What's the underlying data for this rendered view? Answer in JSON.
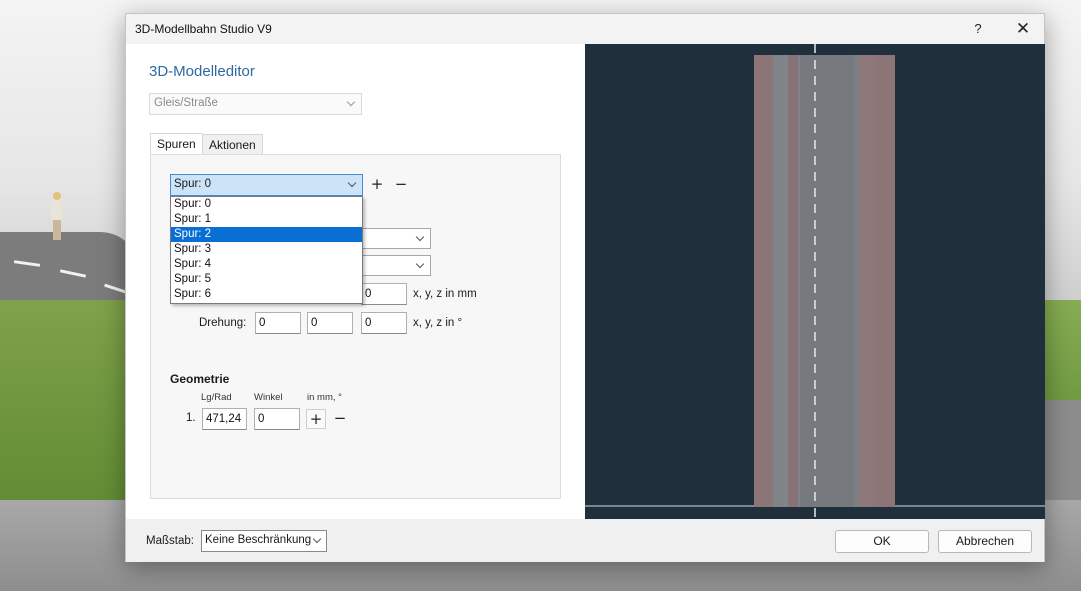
{
  "window": {
    "title": "3D-Modellbahn Studio V9",
    "help_label": "?",
    "close_label": "✕"
  },
  "editor": {
    "heading": "3D-Modelleditor",
    "type_select": {
      "value": "Gleis/Straße"
    },
    "tabs": [
      {
        "label": "Spuren",
        "active": true
      },
      {
        "label": "Aktionen",
        "active": false
      }
    ],
    "spur_select": {
      "value": "Spur: 0"
    },
    "add_label": "+",
    "remove_label": "−",
    "spur_options": [
      "Spur: 0",
      "Spur: 1",
      "Spur: 2",
      "Spur: 3",
      "Spur: 4",
      "Spur: 5",
      "Spur: 6"
    ],
    "highlighted_option": "Spur: 2",
    "position": {
      "z_value": "0",
      "unit_label": "x, y, z in mm"
    },
    "rotation": {
      "label": "Drehung:",
      "x": "0",
      "y": "0",
      "z": "0",
      "unit_label": "x, y, z in °"
    },
    "geometry": {
      "heading": "Geometrie",
      "col_length": "Lg/Rad",
      "col_angle": "Winkel",
      "col_unit": "in mm, °",
      "rows": [
        {
          "index": "1.",
          "length": "471,24",
          "angle": "0"
        }
      ],
      "add_label": "+",
      "remove_label": "−"
    }
  },
  "bottom": {
    "scale_label": "Maßstab:",
    "scale_value": "Keine Beschränkung",
    "ok_label": "OK",
    "cancel_label": "Abbrechen"
  },
  "colors": {
    "heading": "#2d6aa1",
    "preview_bg": "#1f2f3b",
    "selection": "#0a6fd4",
    "road_asphalt": "#767a7f",
    "road_sidewalk": "#8b7577"
  }
}
